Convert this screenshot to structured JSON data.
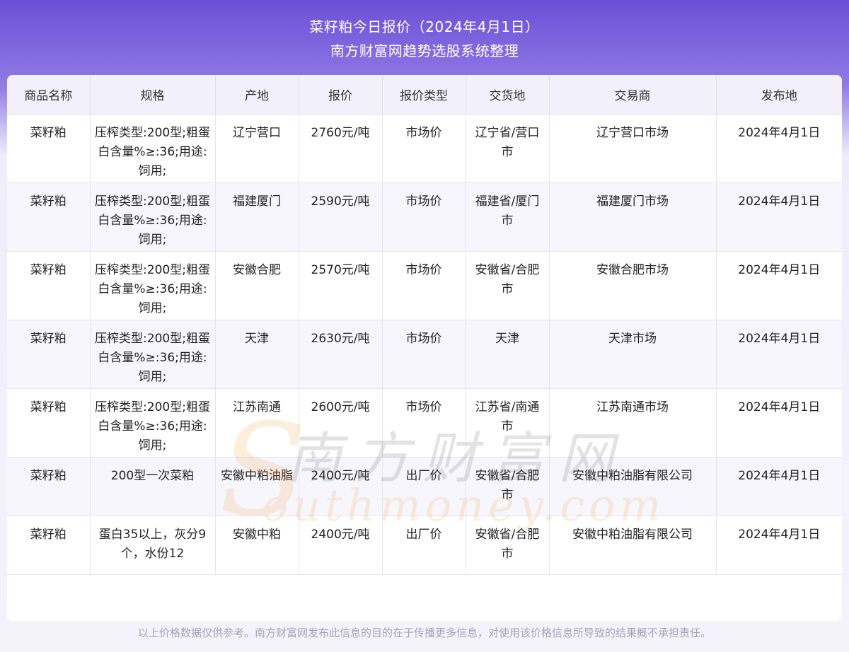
{
  "header": {
    "title": "菜籽粕今日报价（2024年4月1日）",
    "subtitle": "南方财富网趋势选股系统整理"
  },
  "table": {
    "columns": [
      "商品名称",
      "规格",
      "产地",
      "报价",
      "报价类型",
      "交货地",
      "交易商",
      "发布地"
    ],
    "rows": [
      {
        "name": "菜籽粕",
        "spec": "压榨类型:200型;粗蛋白含量%≥:36;用途:饲用;",
        "origin": "辽宁营口",
        "price": "2760元/吨",
        "price_type": "市场价",
        "delivery": "辽宁省/营口市",
        "trader": "辽宁营口市场",
        "date": "2024年4月1日"
      },
      {
        "name": "菜籽粕",
        "spec": "压榨类型:200型;粗蛋白含量%≥:36;用途:饲用;",
        "origin": "福建厦门",
        "price": "2590元/吨",
        "price_type": "市场价",
        "delivery": "福建省/厦门市",
        "trader": "福建厦门市场",
        "date": "2024年4月1日"
      },
      {
        "name": "菜籽粕",
        "spec": "压榨类型:200型;粗蛋白含量%≥:36;用途:饲用;",
        "origin": "安徽合肥",
        "price": "2570元/吨",
        "price_type": "市场价",
        "delivery": "安徽省/合肥市",
        "trader": "安徽合肥市场",
        "date": "2024年4月1日"
      },
      {
        "name": "菜籽粕",
        "spec": "压榨类型:200型;粗蛋白含量%≥:36;用途:饲用;",
        "origin": "天津",
        "price": "2630元/吨",
        "price_type": "市场价",
        "delivery": "天津",
        "trader": "天津市场",
        "date": "2024年4月1日"
      },
      {
        "name": "菜籽粕",
        "spec": "压榨类型:200型;粗蛋白含量%≥:36;用途:饲用;",
        "origin": "江苏南通",
        "price": "2600元/吨",
        "price_type": "市场价",
        "delivery": "江苏省/南通市",
        "trader": "江苏南通市场",
        "date": "2024年4月1日"
      },
      {
        "name": "菜籽粕",
        "spec": "200型一次菜粕",
        "origin": "安徽中粕油脂",
        "price": "2400元/吨",
        "price_type": "出厂价",
        "delivery": "安徽省/合肥市",
        "trader": "安徽中粕油脂有限公司",
        "date": "2024年4月1日"
      },
      {
        "name": "菜籽粕",
        "spec": "蛋白35以上，灰分9个，水份12",
        "origin": "安徽中粕",
        "price": "2400元/吨",
        "price_type": "出厂价",
        "delivery": "安徽省/合肥市",
        "trader": "安徽中粕油脂有限公司",
        "date": "2024年4月1日"
      }
    ]
  },
  "watermark": {
    "logo_letter": "S",
    "text_cn": "南方财富网",
    "text_en": "outhmoney.com"
  },
  "footer": {
    "disclaimer": "以上价格数据仅供参考。南方财富网发布此信息的目的在于传播更多信息，对使用该价格信息所导致的结果概不承担责任。"
  },
  "colors": {
    "header_gradient_top": "#6c4fd6",
    "header_bg_light": "#f2f0fb",
    "row_alt": "#f7f6fd",
    "watermark_orange": "#f29a2e"
  }
}
